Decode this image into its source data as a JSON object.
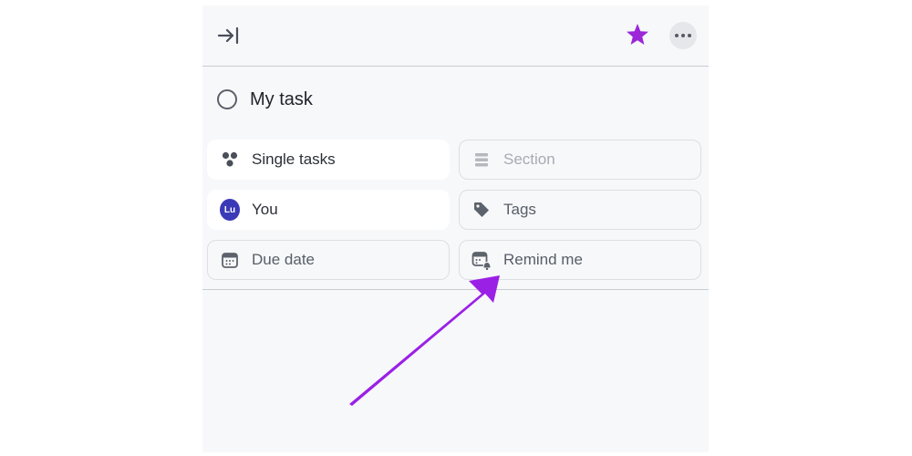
{
  "task": {
    "title": "My task"
  },
  "chips": {
    "single_tasks": "Single tasks",
    "section": "Section",
    "assignee": "You",
    "assignee_initials": "Lu",
    "tags": "Tags",
    "due_date": "Due date",
    "remind_me": "Remind me"
  },
  "icons": {
    "collapse": "collapse-panel-icon",
    "favorite": "star-icon",
    "more": "more-options-icon"
  },
  "colors": {
    "star": "#9b27d8",
    "annotation_arrow": "#9b20e6",
    "avatar": "#3a3ab8"
  }
}
